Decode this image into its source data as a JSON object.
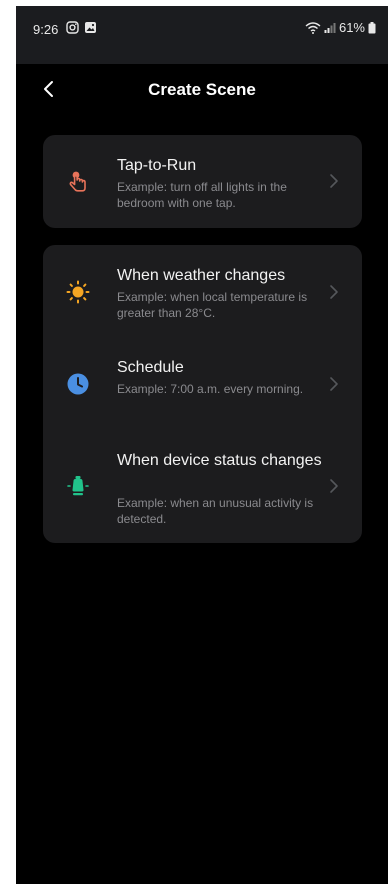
{
  "status_bar": {
    "time": "9:26",
    "battery": "61%"
  },
  "header": {
    "title": "Create Scene"
  },
  "tap_to_run": {
    "label": "Tap-to-Run",
    "desc": "Example: turn off all lights in the bedroom with one tap.",
    "icon": "tap-hand-icon",
    "color": "#e8735a"
  },
  "conditions": [
    {
      "label": "When weather changes",
      "desc": "Example: when local temperature is greater than 28°C.",
      "icon": "sun-icon",
      "color": "#f5a623"
    },
    {
      "label": "Schedule",
      "desc": "Example: 7:00 a.m. every morning.",
      "icon": "clock-icon",
      "color": "#4a8fe2"
    },
    {
      "label": "When device status changes",
      "desc": "Example: when an unusual activity is detected.",
      "icon": "device-icon",
      "color": "#21c38b"
    }
  ]
}
